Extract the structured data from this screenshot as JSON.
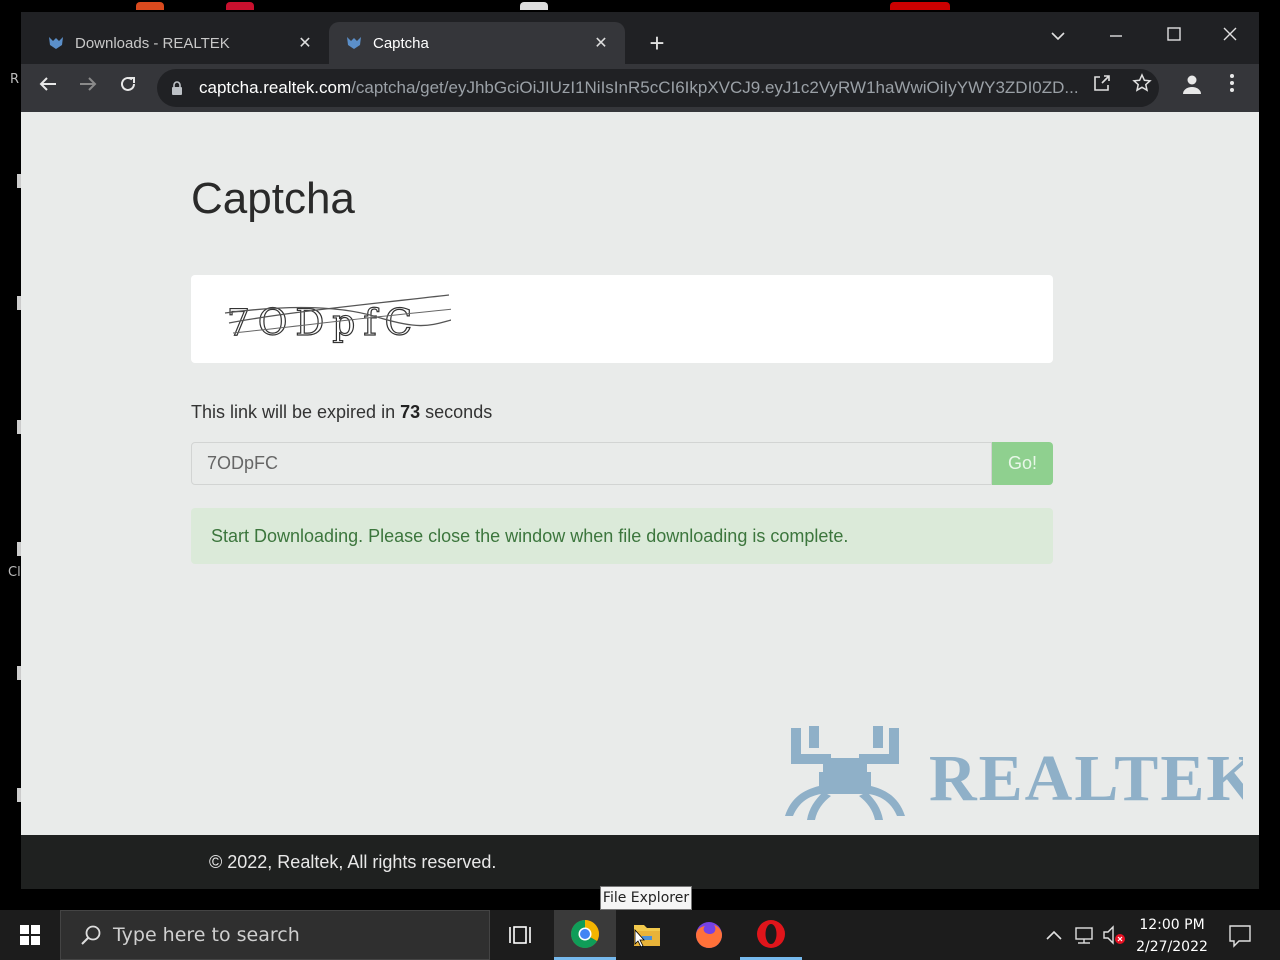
{
  "desktop": {
    "fragments": [
      "R",
      "Cl"
    ]
  },
  "browser": {
    "tabs": [
      {
        "title": "Downloads - REALTEK",
        "close": "✕"
      },
      {
        "title": "Captcha",
        "close": "✕"
      }
    ],
    "new_tab": "+",
    "omnibox": {
      "host": "captcha.realtek.com",
      "path": "/captcha/get/eyJhbGciOiJIUzI1NiIsInR5cCI6IkpXVCJ9.eyJ1c2VyRW1haWwiOiIyYWY3ZDI0ZD..."
    }
  },
  "page": {
    "title": "Captcha",
    "captcha_text": "7ODpfC",
    "expiry_prefix": "This link will be expired in",
    "expiry_seconds": "73",
    "expiry_suffix": "seconds",
    "input_value": "7ODpFC",
    "go_label": "Go!",
    "alert_text": "Start Downloading. Please close the window when file downloading is complete.",
    "logo_text": "REALTEK",
    "footer_text": "© 2022, Realtek, All rights reserved."
  },
  "tooltip": {
    "text": "File Explorer"
  },
  "taskbar": {
    "search_placeholder": "Type here to search",
    "apps": [
      "task-view",
      "chrome",
      "file-explorer",
      "firefox",
      "opera"
    ],
    "time": "12:00 PM",
    "date": "2/27/2022"
  },
  "colors": {
    "go_button": "#8fd08f",
    "alert_bg": "#dbead9",
    "alert_text": "#3c763d",
    "logo": "#8fb0c8",
    "taskbar_accent": "#76b9ed"
  }
}
